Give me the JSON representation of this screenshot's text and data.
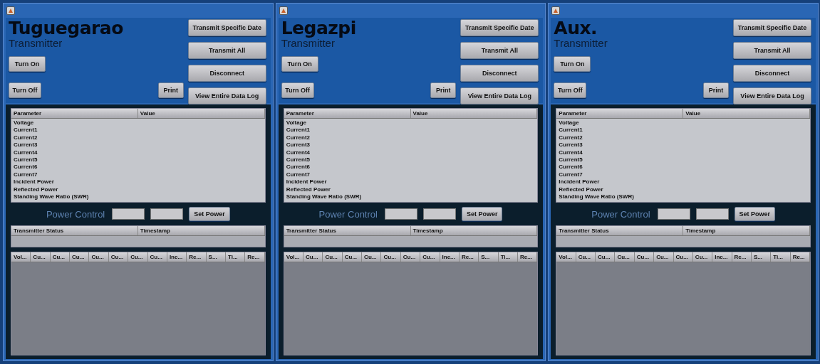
{
  "windows": [
    {
      "station": "Tuguegarao",
      "subtitle": "Transmitter",
      "left_buttons": [
        "Turn On",
        "Turn Off"
      ],
      "print_button": "Print",
      "right_buttons": [
        "Transmit Specific Date",
        "Transmit All",
        "Disconnect",
        "View Entire Data Log"
      ],
      "parameter_table": {
        "columns": [
          "Parameter",
          "Value"
        ],
        "rows": [
          "Voltage",
          "Current1",
          "Current2",
          "Current3",
          "Current4",
          "Current5",
          "Current6",
          "Current7",
          "Incident Power",
          "Reflected Power",
          "Standing Wave Ratio (SWR)"
        ]
      },
      "power_control": {
        "label": "Power Control",
        "button": "Set Power"
      },
      "status_table": {
        "columns": [
          "Transmitter Status",
          "Timestamp"
        ]
      },
      "data_table": {
        "columns": [
          "Vol...",
          "Cu...",
          "Cu...",
          "Cu...",
          "Cu...",
          "Cu...",
          "Cu...",
          "Cu...",
          "Inc...",
          "Re...",
          "S...",
          "Ti...",
          "Re..."
        ]
      }
    },
    {
      "station": "Legazpi",
      "subtitle": "Transmitter",
      "left_buttons": [
        "Turn On",
        "Turn Off"
      ],
      "print_button": "Print",
      "right_buttons": [
        "Transmit Specific Date",
        "Transmit All",
        "Disconnect",
        "View Entire Data Log"
      ],
      "parameter_table": {
        "columns": [
          "Parameter",
          "Value"
        ],
        "rows": [
          "Voltage",
          "Current1",
          "Current2",
          "Current3",
          "Current4",
          "Current5",
          "Current6",
          "Current7",
          "Incident Power",
          "Reflected Power",
          "Standing Wave Ratio (SWR)"
        ]
      },
      "power_control": {
        "label": "Power Control",
        "button": "Set Power"
      },
      "status_table": {
        "columns": [
          "Transmitter Status",
          "Timestamp"
        ]
      },
      "data_table": {
        "columns": [
          "Vol...",
          "Cu...",
          "Cu...",
          "Cu...",
          "Cu...",
          "Cu...",
          "Cu...",
          "Cu...",
          "Inc...",
          "Re...",
          "S...",
          "Ti...",
          "Re..."
        ]
      }
    },
    {
      "station": "Aux.",
      "subtitle": "Transmitter",
      "left_buttons": [
        "Turn On",
        "Turn Off"
      ],
      "print_button": "Print",
      "right_buttons": [
        "Transmit Specific Date",
        "Transmit All",
        "Disconnect",
        "View Entire Data Log"
      ],
      "parameter_table": {
        "columns": [
          "Parameter",
          "Value"
        ],
        "rows": [
          "Voltage",
          "Current1",
          "Current2",
          "Current3",
          "Current4",
          "Current5",
          "Current6",
          "Current7",
          "Incident Power",
          "Reflected Power",
          "Standing Wave Ratio (SWR)"
        ]
      },
      "power_control": {
        "label": "Power Control",
        "button": "Set Power"
      },
      "status_table": {
        "columns": [
          "Transmitter Status",
          "Timestamp"
        ]
      },
      "data_table": {
        "columns": [
          "Vol...",
          "Cu...",
          "Cu...",
          "Cu...",
          "Cu...",
          "Cu...",
          "Cu...",
          "Cu...",
          "Inc...",
          "Re...",
          "S...",
          "Ti...",
          "Re..."
        ]
      }
    }
  ]
}
